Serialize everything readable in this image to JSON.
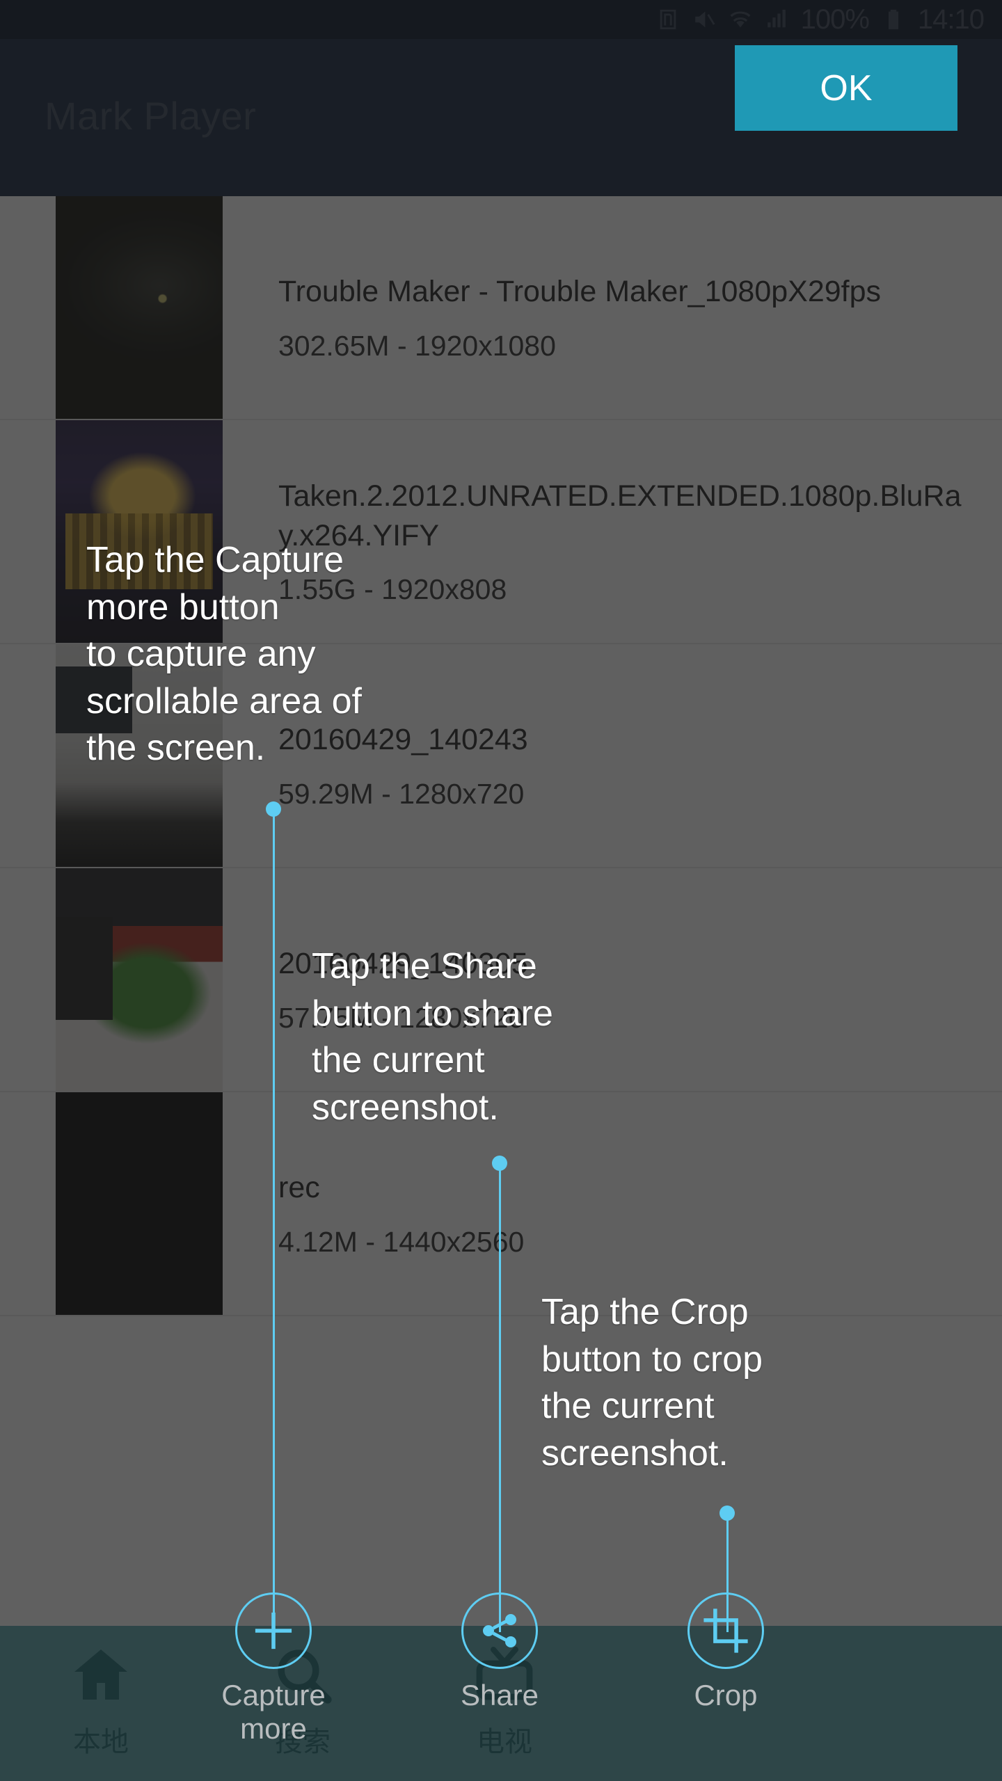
{
  "statusbar": {
    "icons": [
      "nfc-icon",
      "mute-icon",
      "wifi-icon",
      "signal-icon"
    ],
    "battery_percent": "100%",
    "battery_icon": "battery-full-icon",
    "time": "14:10"
  },
  "appbar": {
    "title": "Mark Player"
  },
  "list": {
    "items": [
      {
        "title": "Trouble Maker - Trouble Maker_1080pX29fps",
        "subtitle": "302.65M - 1920x1080",
        "art": "art-cat"
      },
      {
        "title": "Taken.2.2012.UNRATED.EXTENDED.1080p.BluRay.x264.YIFY",
        "subtitle": "1.55G - 1920x808",
        "art": "art-fox"
      },
      {
        "title": "20160429_140243",
        "subtitle": "59.29M - 1280x720",
        "art": "art-desk1"
      },
      {
        "title": "20160429_140305",
        "subtitle": "57.75M - 1280x720",
        "art": "art-plant"
      },
      {
        "title": "rec",
        "subtitle": "4.12M - 1440x2560",
        "art": "art-black"
      }
    ]
  },
  "bottom_nav": {
    "tabs": [
      {
        "label": "本地",
        "icon": "home-icon"
      },
      {
        "label": "搜索",
        "icon": "search-icon"
      },
      {
        "label": "电视",
        "icon": "tv-icon"
      }
    ]
  },
  "coach_overlay": {
    "ok_label": "OK",
    "accent_color": "#5ecdf2",
    "ok_color": "#1f99b5",
    "tips": [
      {
        "text": "Tap the Capture\nmore button\nto capture any\nscrollable area of\nthe screen."
      },
      {
        "text": "Tap the Share\nbutton to share\nthe current\nscreenshot."
      },
      {
        "text": "Tap the Crop\nbutton to crop\nthe current\nscreenshot."
      }
    ],
    "buttons": [
      {
        "label": "Capture\nmore",
        "icon": "plus-icon"
      },
      {
        "label": "Share",
        "icon": "share-icon"
      },
      {
        "label": "Crop",
        "icon": "crop-icon"
      }
    ]
  }
}
